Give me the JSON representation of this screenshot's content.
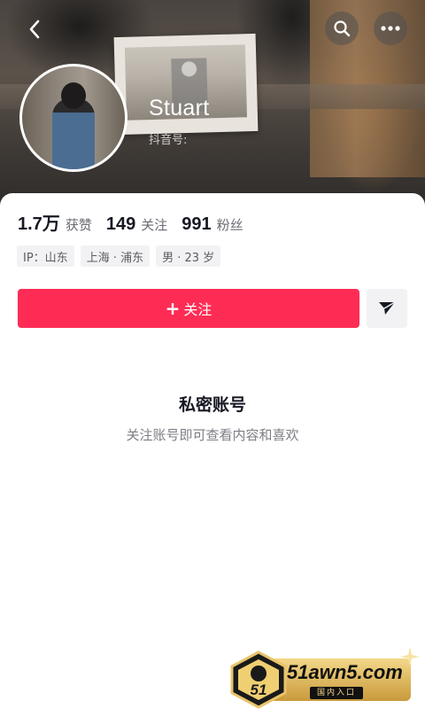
{
  "header": {
    "username": "Stuart",
    "douyin_id_label": "抖音号:"
  },
  "stats": [
    {
      "value": "1.7万",
      "label": "获赞"
    },
    {
      "value": "149",
      "label": "关注"
    },
    {
      "value": "991",
      "label": "粉丝"
    }
  ],
  "tags": [
    "IP：山东",
    "上海 · 浦东",
    "男 · 23 岁"
  ],
  "actions": {
    "follow_label": "关注",
    "follow_plus": "+"
  },
  "private": {
    "title": "私密账号",
    "description": "关注账号即可查看内容和喜欢"
  },
  "watermark": {
    "site": "51awn5.com",
    "sub": "国内入口",
    "badge": "51"
  },
  "colors": {
    "accent": "#fe2c55",
    "text": "#161823",
    "secondary": "#6a6b73",
    "tag_bg": "#f2f2f4"
  },
  "icons": [
    "back-arrow-icon",
    "search-icon",
    "more-icon",
    "share-send-icon"
  ]
}
